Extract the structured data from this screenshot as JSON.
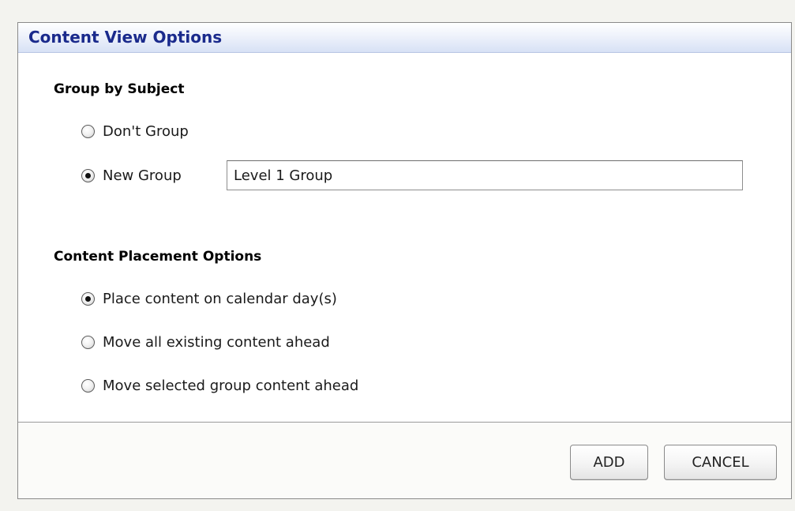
{
  "dialog": {
    "title": "Content View Options"
  },
  "group_by_subject": {
    "heading": "Group by Subject",
    "options": [
      {
        "label": "Don't Group",
        "checked": false
      },
      {
        "label": "New Group",
        "checked": true
      }
    ],
    "group_name_value": "Level 1 Group"
  },
  "content_placement": {
    "heading": "Content Placement Options",
    "options": [
      {
        "label": "Place content on calendar day(s)",
        "checked": true
      },
      {
        "label": "Move all existing content ahead",
        "checked": false
      },
      {
        "label": "Move selected group content ahead",
        "checked": false
      }
    ]
  },
  "buttons": {
    "add_label": "ADD",
    "cancel_label": "CANCEL"
  },
  "colors": {
    "title_text": "#1a2a8c",
    "title_bar_end": "#d7e1f5",
    "page_background": "#f3f3ef"
  }
}
